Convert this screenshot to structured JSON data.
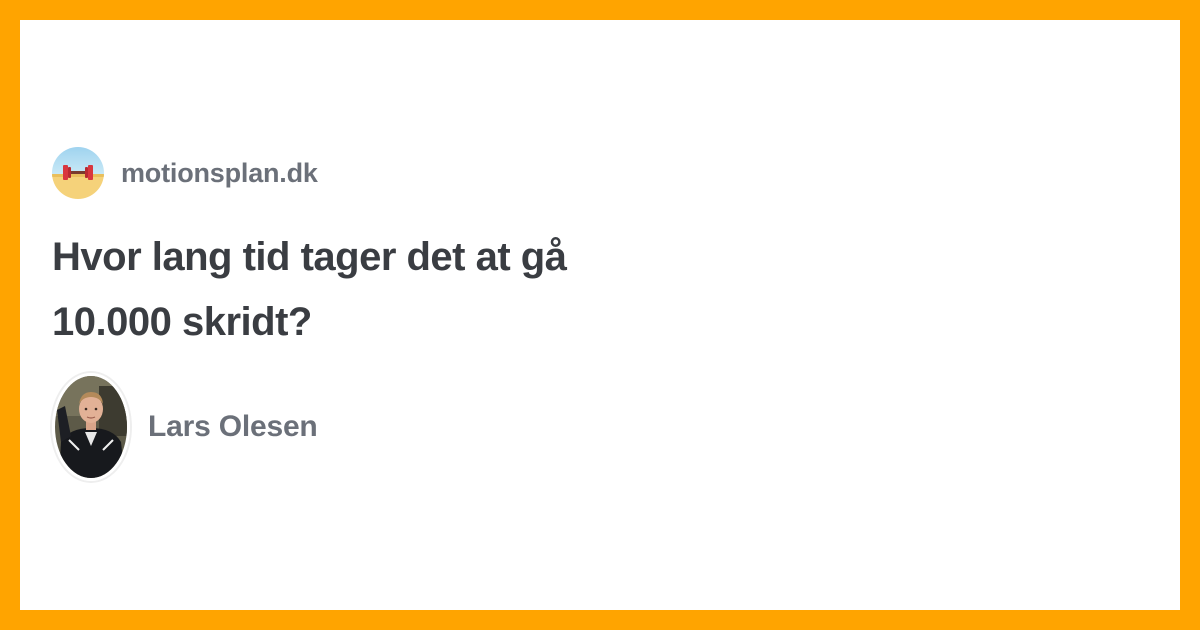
{
  "site": {
    "name": "motionsplan.dk",
    "logo_icon": "dumbbell-beach-icon"
  },
  "article": {
    "title": "Hvor lang tid tager det at gå 10.000 skridt?"
  },
  "author": {
    "name": "Lars Olesen",
    "avatar_icon": "author-photo"
  },
  "colors": {
    "frame": "#FFA400",
    "card": "#FFFFFF",
    "title_text": "#3A3D42",
    "meta_text": "#6B7079"
  }
}
